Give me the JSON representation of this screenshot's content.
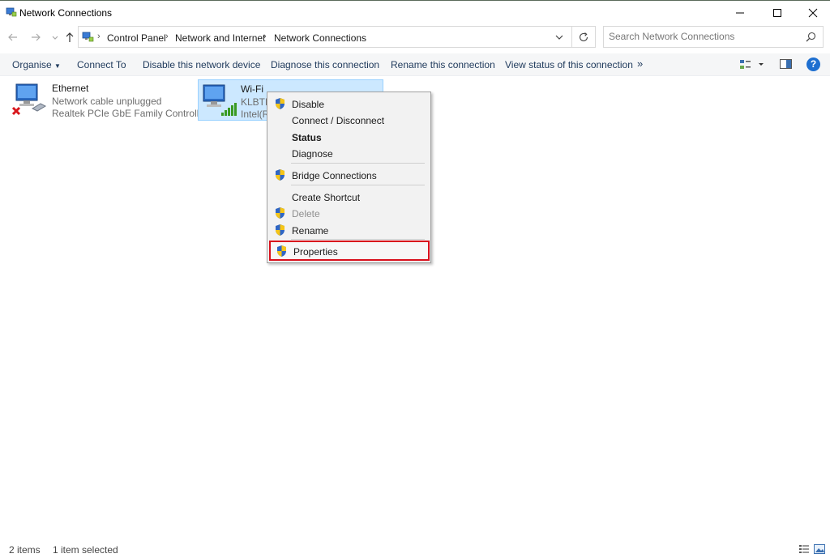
{
  "window": {
    "title": "Network Connections",
    "icon": "network-connections-icon"
  },
  "nav": {
    "back": "back-arrow-icon",
    "forward": "forward-arrow-icon",
    "recent": "chevron-down-icon",
    "up": "up-arrow-icon"
  },
  "address": {
    "crumbs": [
      "Control Panel",
      "Network and Internet",
      "Network Connections"
    ],
    "separator": "›"
  },
  "search": {
    "placeholder": "Search Network Connections"
  },
  "commands": {
    "organise": "Organise",
    "connect_to": "Connect To",
    "disable": "Disable this network device",
    "diagnose": "Diagnose this connection",
    "rename": "Rename this connection",
    "view_status": "View status of this connection",
    "more": "»",
    "help": "?"
  },
  "items": [
    {
      "name": "Ethernet",
      "status": "Network cable unplugged",
      "device": "Realtek PCIe GbE Family Controller",
      "icon": "ethernet-disconnected-icon"
    },
    {
      "name": "Wi-Fi",
      "status": "KLBTH",
      "device": "Intel(R",
      "icon": "wifi-adapter-icon",
      "selected": true
    }
  ],
  "context_menu": {
    "items": [
      {
        "label": "Disable",
        "shield": true
      },
      {
        "label": "Connect / Disconnect",
        "shield": false
      },
      {
        "label": "Status",
        "shield": false,
        "bold": true
      },
      {
        "label": "Diagnose",
        "shield": false
      },
      {
        "label": "Bridge Connections",
        "shield": true
      },
      {
        "label": "Create Shortcut",
        "shield": false
      },
      {
        "label": "Delete",
        "shield": true,
        "disabled": true
      },
      {
        "label": "Rename",
        "shield": true
      },
      {
        "label": "Properties",
        "shield": true,
        "highlighted": true
      }
    ]
  },
  "statusbar": {
    "count": "2 items",
    "selection": "1 item selected"
  },
  "colors": {
    "selection_bg": "#cce8ff",
    "selection_border": "#99d1ff",
    "highlight_box": "#d9101c",
    "command_text": "#1e395b",
    "help_blue": "#1e6fd0"
  }
}
